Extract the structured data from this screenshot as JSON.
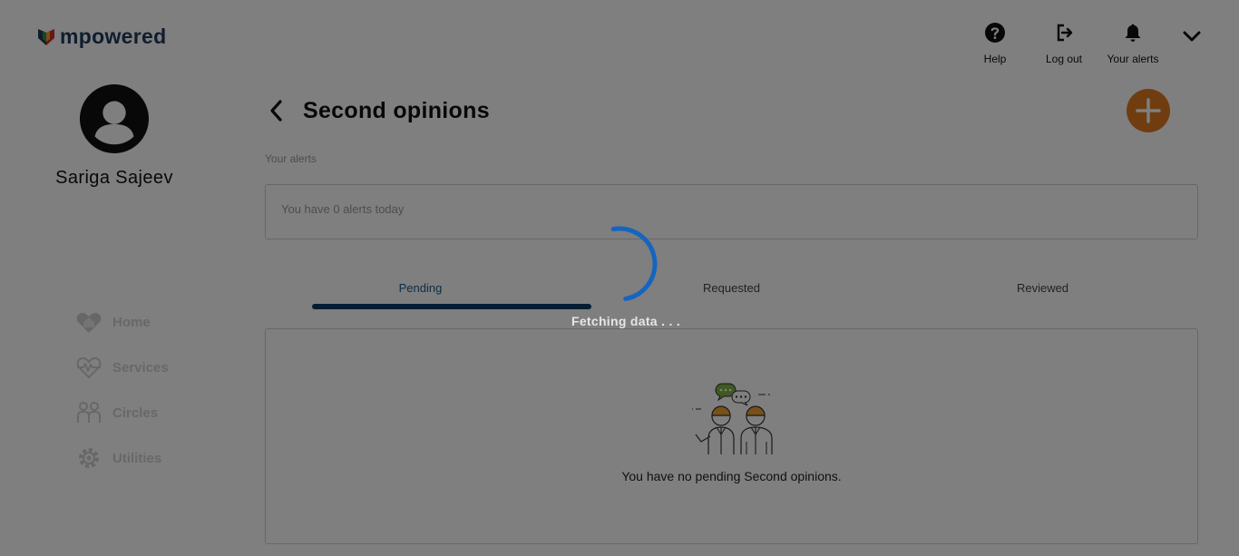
{
  "header": {
    "logo_text": "mpowered",
    "actions": [
      {
        "label": "Help",
        "icon": "help-icon"
      },
      {
        "label": "Log out",
        "icon": "logout-icon"
      },
      {
        "label": "Your alerts",
        "icon": "bell-icon"
      }
    ],
    "menu_icon": "chevron-down-icon"
  },
  "sidebar": {
    "user_name": "Sariga Sajeev",
    "nav": [
      {
        "label": "Home",
        "icon": "heart-home-icon"
      },
      {
        "label": "Services",
        "icon": "heartbeat-icon"
      },
      {
        "label": "Circles",
        "icon": "people-icon"
      },
      {
        "label": "Utilities",
        "icon": "gear-icon"
      }
    ]
  },
  "main": {
    "title": "Second opinions",
    "alerts_label": "Your alerts",
    "alerts_text": "You have 0 alerts today",
    "tabs": [
      {
        "label": "Pending",
        "active": true
      },
      {
        "label": "Requested",
        "active": false
      },
      {
        "label": "Reviewed",
        "active": false
      }
    ],
    "empty_message": "You have no pending Second opinions."
  },
  "overlay": {
    "loading_text": "Fetching data . . ."
  },
  "colors": {
    "brand_navy": "#1f3a5a",
    "accent_orange": "#e07b22",
    "tab_indicator": "#0c3d66",
    "spinner_blue": "#1565c0"
  }
}
